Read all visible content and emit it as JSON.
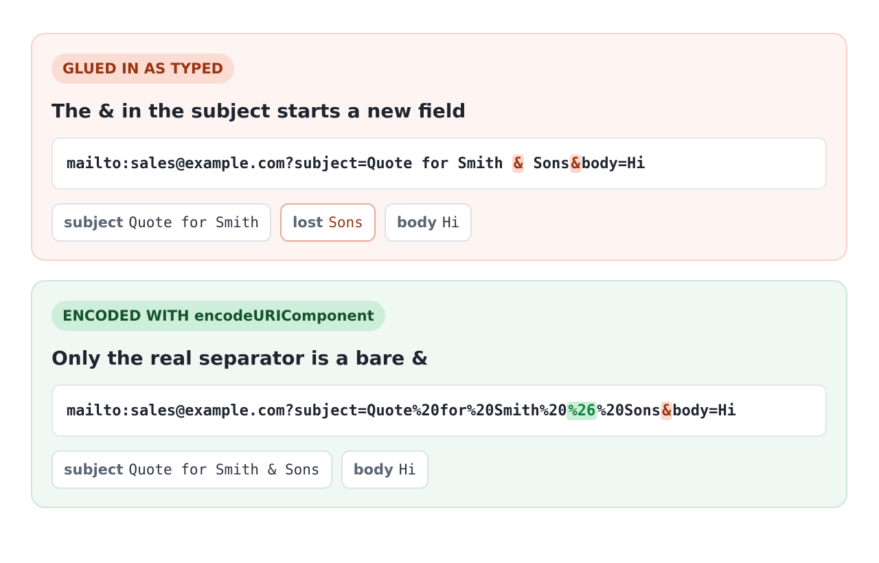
{
  "panels": {
    "glued": {
      "badge": "GLUED IN AS TYPED",
      "headline": "The & in the subject starts a new field",
      "uri": {
        "prefix": "mailto:sales@example.com?subject=Quote for Smith ",
        "highlight1": "&",
        "middle": " Sons",
        "highlight2": "&",
        "suffix": "body=Hi"
      },
      "chips": [
        {
          "key": "subject",
          "value": "Quote for Smith"
        },
        {
          "key": "lost",
          "value": "Sons"
        },
        {
          "key": "body",
          "value": "Hi"
        }
      ]
    },
    "encoded": {
      "badge": "ENCODED WITH encodeURIComponent",
      "headline": "Only the real separator is a bare &",
      "uri": {
        "prefix": "mailto:sales@example.com?subject=Quote%20for%20Smith%20",
        "highlight1": "%26",
        "middle": "%20Sons",
        "highlight2": "&",
        "suffix": "body=Hi"
      },
      "chips": [
        {
          "key": "subject",
          "value": "Quote for Smith & Sons"
        },
        {
          "key": "body",
          "value": "Hi"
        }
      ]
    }
  },
  "colors": {
    "bad_accent": "#9a3412",
    "good_accent": "#15803d"
  }
}
